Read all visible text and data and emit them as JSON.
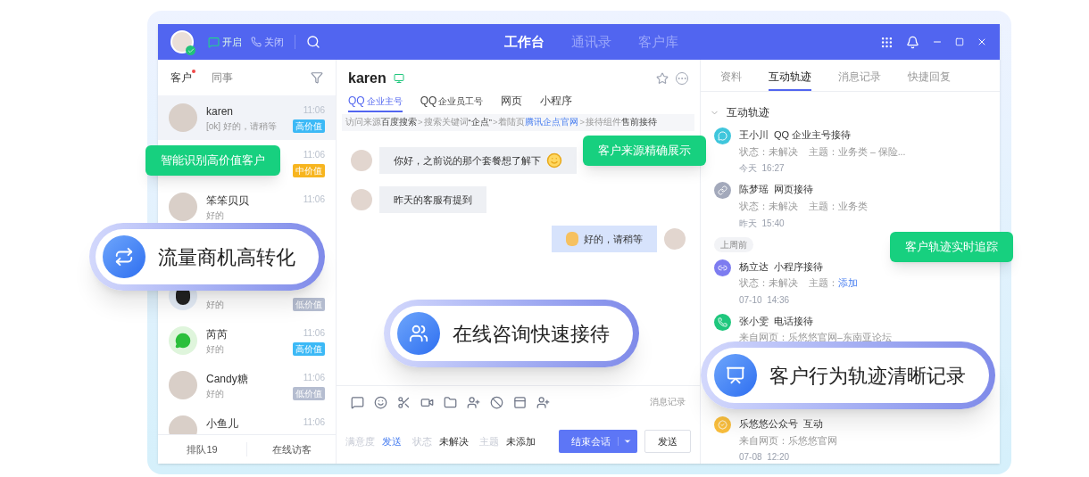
{
  "topbar": {
    "toggles": [
      {
        "label": "开启"
      },
      {
        "label": "关闭"
      }
    ],
    "nav": [
      {
        "label": "工作台",
        "selected": true
      },
      {
        "label": "通讯录",
        "selected": false
      },
      {
        "label": "客户库",
        "selected": false
      }
    ]
  },
  "customer_panel": {
    "tabs": [
      {
        "label": "客户",
        "selected": true,
        "dot": true
      },
      {
        "label": "同事",
        "selected": false,
        "dot": false
      }
    ],
    "customers": [
      {
        "name": "karen",
        "preview": "[ok] 好的，请稍等",
        "time": "11:06",
        "tag": {
          "text": "高价值",
          "color": "#3cb9f6"
        },
        "selected": true
      },
      {
        "time": "11:06",
        "tag": {
          "text": "中价值",
          "color": "#f7b51f"
        },
        "selected": false
      },
      {
        "name": "笨笨贝贝",
        "preview": "好的",
        "time": "11:06",
        "selected": false
      },
      {
        "preview": "好的",
        "tag": {
          "text": "低价值",
          "color": "#b5bdd0"
        },
        "selected": false
      },
      {
        "name": "芮芮",
        "preview": "好的",
        "time": "11:06",
        "tag": {
          "text": "高价值",
          "color": "#3cb9f6"
        },
        "selected": false
      },
      {
        "name": "Candy糖",
        "preview": "好的",
        "time": "11:06",
        "tag": {
          "text": "低价值",
          "color": "#b5bdd0"
        },
        "selected": false
      },
      {
        "name": "小鱼儿",
        "time": "11:06",
        "selected": false
      }
    ],
    "footer": [
      "排队19",
      "在线访客"
    ]
  },
  "chat": {
    "name": "karen",
    "channels": [
      {
        "main": "QQ",
        "sub": "企业主号",
        "selected": true
      },
      {
        "main": "QQ",
        "sub": "企业员工号",
        "selected": false
      },
      {
        "main": "网页",
        "selected": false
      },
      {
        "main": "小程序",
        "selected": false
      }
    ],
    "source_separator": ">",
    "source": [
      {
        "label": "访问来源",
        "value": "百度搜索",
        "link": false
      },
      {
        "label": "搜索关键词",
        "value": "“企点”",
        "link": false
      },
      {
        "label": "着陆页",
        "value": "腾讯企点官网",
        "link": true
      },
      {
        "label": "接待组件",
        "value": "售前接待",
        "link": false
      }
    ],
    "messages": [
      {
        "outgoing": false,
        "text": "你好，之前说的那个套餐想了解下"
      },
      {
        "outgoing": false,
        "text": "昨天的客服有提到"
      },
      {
        "outgoing": true,
        "text": "好的，请稍等"
      }
    ],
    "history_link": "消息记录",
    "fields": [
      {
        "label": "满意度",
        "value": "发送",
        "link": true
      },
      {
        "label": "状态",
        "value": "未解决",
        "link": false
      },
      {
        "label": "主题",
        "value": "未添加",
        "link": false
      }
    ],
    "end_button": "结束会话",
    "send_button": "发送"
  },
  "detail_panel": {
    "tabs": [
      {
        "label": "资料",
        "selected": false
      },
      {
        "label": "互动轨迹",
        "selected": true
      },
      {
        "label": "消息记录",
        "selected": false
      },
      {
        "label": "快捷回复",
        "selected": false
      }
    ],
    "section": {
      "title": "互动轨迹",
      "expanded": true
    },
    "timeline": [
      {
        "kind": "event",
        "color": "#3fc6dc",
        "name": "王小川",
        "channel": "QQ 企业主号接待",
        "details": [
          {
            "label": "状态：",
            "value": "未解决",
            "link": false
          },
          {
            "label": "主题：",
            "value": "业务类 – 保险...",
            "link": false
          }
        ],
        "time": "今天  16:27"
      },
      {
        "kind": "event",
        "color": "#a3a9bb",
        "name": "陈梦瑶",
        "channel": "网页接待",
        "details": [
          {
            "label": "状态：",
            "value": "未解决",
            "link": false
          },
          {
            "label": "主题：",
            "value": "业务类",
            "link": false
          }
        ],
        "time": "昨天  15:40"
      },
      {
        "kind": "divider",
        "label": "上周前"
      },
      {
        "kind": "event",
        "color": "#7d7cf0",
        "name": "杨立达",
        "channel": "小程序接待",
        "details": [
          {
            "label": "状态：",
            "value": "未解决",
            "link": false
          },
          {
            "label": "主题：",
            "value": "添加",
            "link": true
          }
        ],
        "time": "07-10  14:36"
      },
      {
        "kind": "event",
        "color": "#1fc77d",
        "name": "张小雯",
        "channel": "电话接待",
        "details": [
          {
            "label": "来自网页：",
            "value": "乐悠悠官网–东南亚论坛",
            "link": false
          }
        ]
      },
      {
        "kind": "event",
        "color": "#f9be3c",
        "name": "乐悠悠公众号",
        "channel": "互动",
        "details": [
          {
            "label": "来自网页：",
            "value": "乐悠悠官网",
            "link": false
          }
        ],
        "time": "07-08  12:20"
      }
    ]
  },
  "callouts": [
    {
      "kind": "tag",
      "text": "智能识别高价值客户"
    },
    {
      "kind": "tag",
      "text": "客户来源精确展示"
    },
    {
      "kind": "tag",
      "text": "客户轨迹实时追踪"
    },
    {
      "kind": "pill",
      "text": "流量商机高转化"
    },
    {
      "kind": "pill",
      "text": "在线咨询快速接待"
    },
    {
      "kind": "pill",
      "text": "客户行为轨迹清晰记录"
    }
  ]
}
